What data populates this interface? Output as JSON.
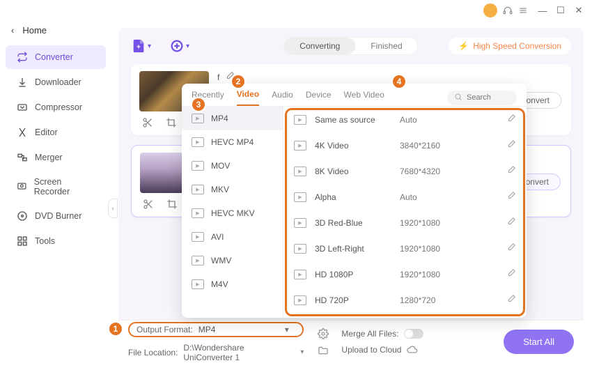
{
  "titlebar": {
    "minimize": "—",
    "maximize": "☐",
    "close": "✕"
  },
  "home_label": "Home",
  "sidebar": {
    "items": [
      {
        "label": "Converter"
      },
      {
        "label": "Downloader"
      },
      {
        "label": "Compressor"
      },
      {
        "label": "Editor"
      },
      {
        "label": "Merger"
      },
      {
        "label": "Screen Recorder"
      },
      {
        "label": "DVD Burner"
      },
      {
        "label": "Tools"
      }
    ]
  },
  "toolbar": {
    "converting": "Converting",
    "finished": "Finished",
    "highspeed": "High Speed Conversion"
  },
  "cards": [
    {
      "filename": "f"
    },
    {
      "filename": ""
    }
  ],
  "convert_label": "Convert",
  "dropdown": {
    "tabs": [
      "Recently",
      "Video",
      "Audio",
      "Device",
      "Web Video"
    ],
    "search_placeholder": "Search",
    "formats": [
      "MP4",
      "HEVC MP4",
      "MOV",
      "MKV",
      "HEVC MKV",
      "AVI",
      "WMV",
      "M4V"
    ],
    "presets": [
      {
        "name": "Same as source",
        "res": "Auto"
      },
      {
        "name": "4K Video",
        "res": "3840*2160"
      },
      {
        "name": "8K Video",
        "res": "7680*4320"
      },
      {
        "name": "Alpha",
        "res": "Auto"
      },
      {
        "name": "3D Red-Blue",
        "res": "1920*1080"
      },
      {
        "name": "3D Left-Right",
        "res": "1920*1080"
      },
      {
        "name": "HD 1080P",
        "res": "1920*1080"
      },
      {
        "name": "HD 720P",
        "res": "1280*720"
      }
    ]
  },
  "bottombar": {
    "output_format_label": "Output Format:",
    "output_format_value": "MP4",
    "file_location_label": "File Location:",
    "file_location_value": "D:\\Wondershare UniConverter 1",
    "merge_label": "Merge All Files:",
    "upload_label": "Upload to Cloud",
    "start_all": "Start All"
  },
  "callouts": {
    "c1": "1",
    "c2": "2",
    "c3": "3",
    "c4": "4"
  }
}
